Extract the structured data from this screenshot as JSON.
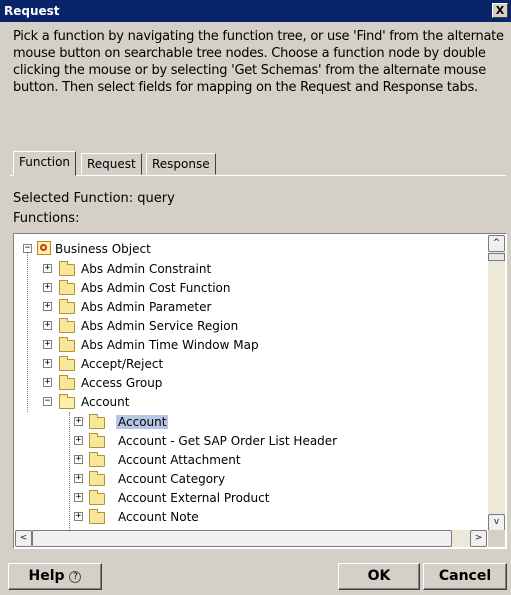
{
  "window": {
    "title": "Request",
    "close_label": "X"
  },
  "instructions": "Pick a function by navigating the function tree, or use 'Find' from the alternate mouse button on searchable tree nodes. Choose a function node by double clicking the mouse or by selecting 'Get Schemas' from the alternate mouse button. Then select fields for mapping on the Request and Response tabs.",
  "tabs": [
    {
      "label": "Function",
      "active": true
    },
    {
      "label": "Request",
      "active": false
    },
    {
      "label": "Response",
      "active": false
    }
  ],
  "selected_function": "Selected Function: query",
  "functions_label": "Functions:",
  "tree": {
    "root": "Business Object",
    "items": [
      {
        "label": "Abs Admin Constraint",
        "level": 1,
        "expanded": false
      },
      {
        "label": "Abs Admin Cost Function",
        "level": 1,
        "expanded": false
      },
      {
        "label": "Abs Admin Parameter",
        "level": 1,
        "expanded": false
      },
      {
        "label": "Abs Admin Service Region",
        "level": 1,
        "expanded": false
      },
      {
        "label": "Abs Admin Time Window Map",
        "level": 1,
        "expanded": false
      },
      {
        "label": "Accept/Reject",
        "level": 1,
        "expanded": false
      },
      {
        "label": "Access Group",
        "level": 1,
        "expanded": false
      },
      {
        "label": "Account",
        "level": 1,
        "expanded": true
      },
      {
        "label": "Account",
        "level": 2,
        "expanded": false,
        "selected": true
      },
      {
        "label": "Account - Get SAP Order List Header",
        "level": 2,
        "expanded": false
      },
      {
        "label": "Account Attachment",
        "level": 2,
        "expanded": false
      },
      {
        "label": "Account Category",
        "level": 2,
        "expanded": false
      },
      {
        "label": "Account External Product",
        "level": 2,
        "expanded": false
      },
      {
        "label": "Account Note",
        "level": 2,
        "expanded": false
      }
    ]
  },
  "buttons": {
    "help": "Help",
    "help_icon": "?",
    "ok": "OK",
    "cancel": "Cancel"
  },
  "scroll_arrows": {
    "up": "^",
    "down": "v",
    "left": "<",
    "right": ">"
  }
}
